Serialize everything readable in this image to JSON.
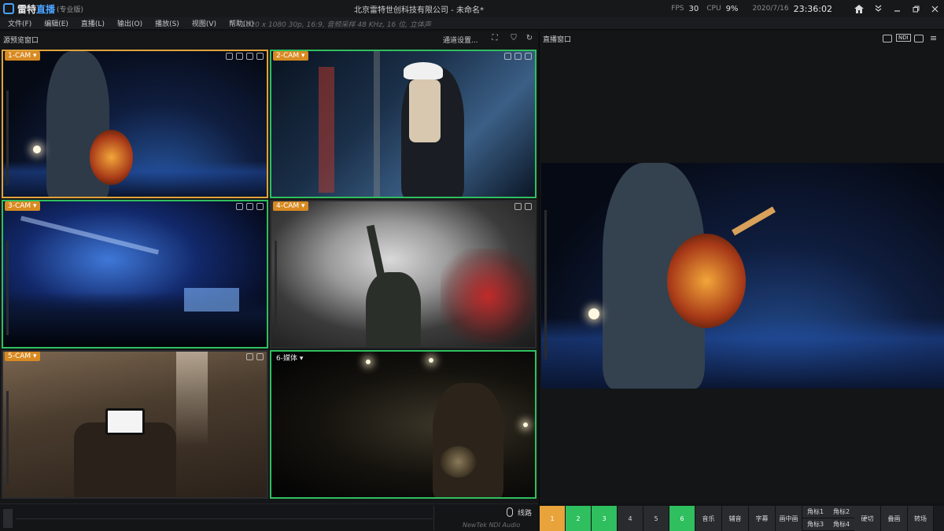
{
  "app": {
    "brand_part1": "雷特",
    "brand_part2": "直播",
    "edition": "(专业版)",
    "window_title": "北京雷特世创科技有限公司 - 未命名*",
    "fps_label": "FPS",
    "fps_value": "30",
    "cpu_label": "CPU",
    "cpu_value": "9%",
    "date": "2020/7/16",
    "time": "23:36:02"
  },
  "menu": {
    "items": [
      "文件(F)",
      "编辑(E)",
      "直播(L)",
      "输出(O)",
      "播放(S)",
      "视图(V)",
      "帮助(H)"
    ],
    "format_info": "1920 x 1080 30p, 16:9, 音频采样 48 KHz, 16 位, 立体声"
  },
  "source_panel": {
    "title": "源预览窗口",
    "settings_label": "通道设置...",
    "tiles": [
      {
        "label": "1-CAM",
        "state": "pgm"
      },
      {
        "label": "2-CAM",
        "state": "pvw"
      },
      {
        "label": "3-CAM",
        "state": "pvw"
      },
      {
        "label": "4-CAM",
        "state": "none"
      },
      {
        "label": "5-CAM",
        "state": "none"
      },
      {
        "label": "6-媒体",
        "state": "pvw"
      }
    ]
  },
  "audio": {
    "line_label": "线路",
    "device": "NewTek NDI Audio"
  },
  "program_panel": {
    "title": "直播窗口",
    "ndi_label": "NDI"
  },
  "switcher": {
    "numbers": [
      "1",
      "2",
      "3",
      "4",
      "5",
      "6"
    ],
    "fx": [
      "音乐",
      "辅音",
      "字幕",
      "画中画"
    ],
    "corner_top": [
      "角标1",
      "角标2"
    ],
    "corner_bottom": [
      "角标3",
      "角标4"
    ],
    "tail": [
      "硬切",
      "叠画",
      "转场"
    ]
  },
  "colors": {
    "program": "#e8a33a",
    "preview": "#2fbf5f",
    "accent": "#4aa3ff"
  }
}
